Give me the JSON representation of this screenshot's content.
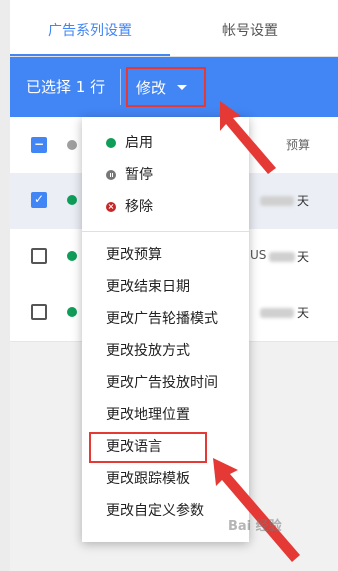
{
  "tabs": [
    {
      "label": "广告系列设置",
      "active": true
    },
    {
      "label": "帐号设置",
      "active": false
    }
  ],
  "actionbar": {
    "selected_text": "已选择 1 行",
    "edit_label": "修改"
  },
  "table": {
    "budget_header": "预算",
    "rows": [
      {
        "selected": true,
        "budget_suffix": "天",
        "extra_fragment": ""
      },
      {
        "selected": false,
        "budget_suffix": "天",
        "extra_fragment": "US"
      },
      {
        "selected": false,
        "budget_suffix": "天",
        "extra_fragment": ""
      }
    ]
  },
  "menu": {
    "status_items": [
      {
        "label": "启用",
        "icon": "enable-dot-icon",
        "color": "#0f9d58"
      },
      {
        "label": "暂停",
        "icon": "pause-icon",
        "color": "#777777"
      },
      {
        "label": "移除",
        "icon": "remove-icon",
        "color": "#c62828"
      }
    ],
    "change_items": [
      "更改预算",
      "更改结束日期",
      "更改广告轮播模式",
      "更改投放方式",
      "更改广告投放时间",
      "更改地理位置",
      "更改语言",
      "更改跟踪模板",
      "更改自定义参数"
    ]
  },
  "colors": {
    "accent": "#4285f4",
    "highlight": "#e53935"
  },
  "watermark": "Bai 经验"
}
